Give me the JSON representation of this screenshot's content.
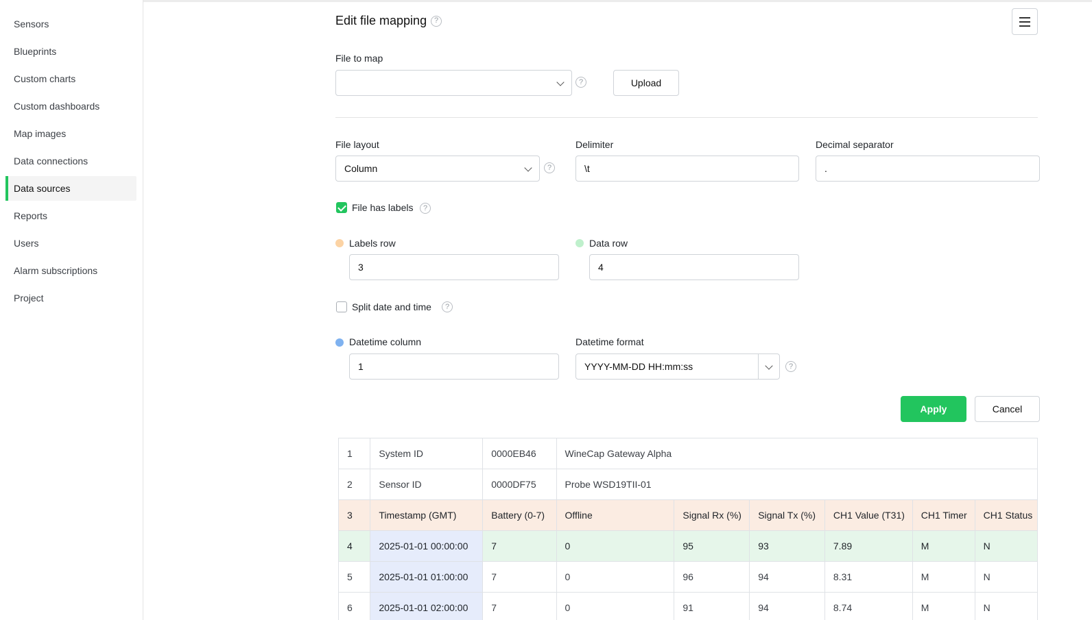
{
  "sidebar": {
    "items": [
      {
        "label": "Sensors"
      },
      {
        "label": "Blueprints"
      },
      {
        "label": "Custom charts"
      },
      {
        "label": "Custom dashboards"
      },
      {
        "label": "Map images"
      },
      {
        "label": "Data connections"
      },
      {
        "label": "Data sources",
        "active": true
      },
      {
        "label": "Reports"
      },
      {
        "label": "Users"
      },
      {
        "label": "Alarm subscriptions"
      },
      {
        "label": "Project"
      }
    ]
  },
  "header": {
    "title": "Edit file mapping"
  },
  "file_to_map": {
    "label": "File to map",
    "value": "",
    "upload_label": "Upload"
  },
  "file_layout": {
    "label": "File layout",
    "value": "Column"
  },
  "delimiter": {
    "label": "Delimiter",
    "value": "\\t"
  },
  "decimal_separator": {
    "label": "Decimal separator",
    "value": "."
  },
  "file_has_labels": {
    "label": "File has labels",
    "checked": true
  },
  "labels_row": {
    "label": "Labels row",
    "value": "3"
  },
  "data_row": {
    "label": "Data row",
    "value": "4"
  },
  "split_date_time": {
    "label": "Split date and time",
    "checked": false
  },
  "datetime_column": {
    "label": "Datetime column",
    "value": "1"
  },
  "datetime_format": {
    "label": "Datetime format",
    "value": "YYYY-MM-DD HH:mm:ss"
  },
  "actions": {
    "apply": "Apply",
    "cancel": "Cancel"
  },
  "colors": {
    "accent": "#22c55e",
    "labels_dot": "#fcd3a4",
    "data_dot": "#bff0cc",
    "datetime_dot": "#7fb2f0"
  },
  "preview": {
    "rows": [
      {
        "num": "1",
        "cells": [
          "System ID",
          "0000EB46",
          "WineCap Gateway Alpha"
        ],
        "type": "meta"
      },
      {
        "num": "2",
        "cells": [
          "Sensor ID",
          "0000DF75",
          "Probe WSD19TII-01"
        ],
        "type": "meta"
      },
      {
        "num": "3",
        "cells": [
          "Timestamp (GMT)",
          "Battery (0-7)",
          "Offline",
          "Signal Rx (%)",
          "Signal Tx (%)",
          "CH1 Value (T31)",
          "CH1 Timer",
          "CH1 Status"
        ],
        "type": "labels"
      },
      {
        "num": "4",
        "cells": [
          "2025-01-01 00:00:00",
          "7",
          "0",
          "95",
          "93",
          "7.89",
          "M",
          "N"
        ],
        "type": "data"
      },
      {
        "num": "5",
        "cells": [
          "2025-01-01 01:00:00",
          "7",
          "0",
          "96",
          "94",
          "8.31",
          "M",
          "N"
        ],
        "type": "plain"
      },
      {
        "num": "6",
        "cells": [
          "2025-01-01 02:00:00",
          "7",
          "0",
          "91",
          "94",
          "8.74",
          "M",
          "N"
        ],
        "type": "plain"
      }
    ]
  }
}
